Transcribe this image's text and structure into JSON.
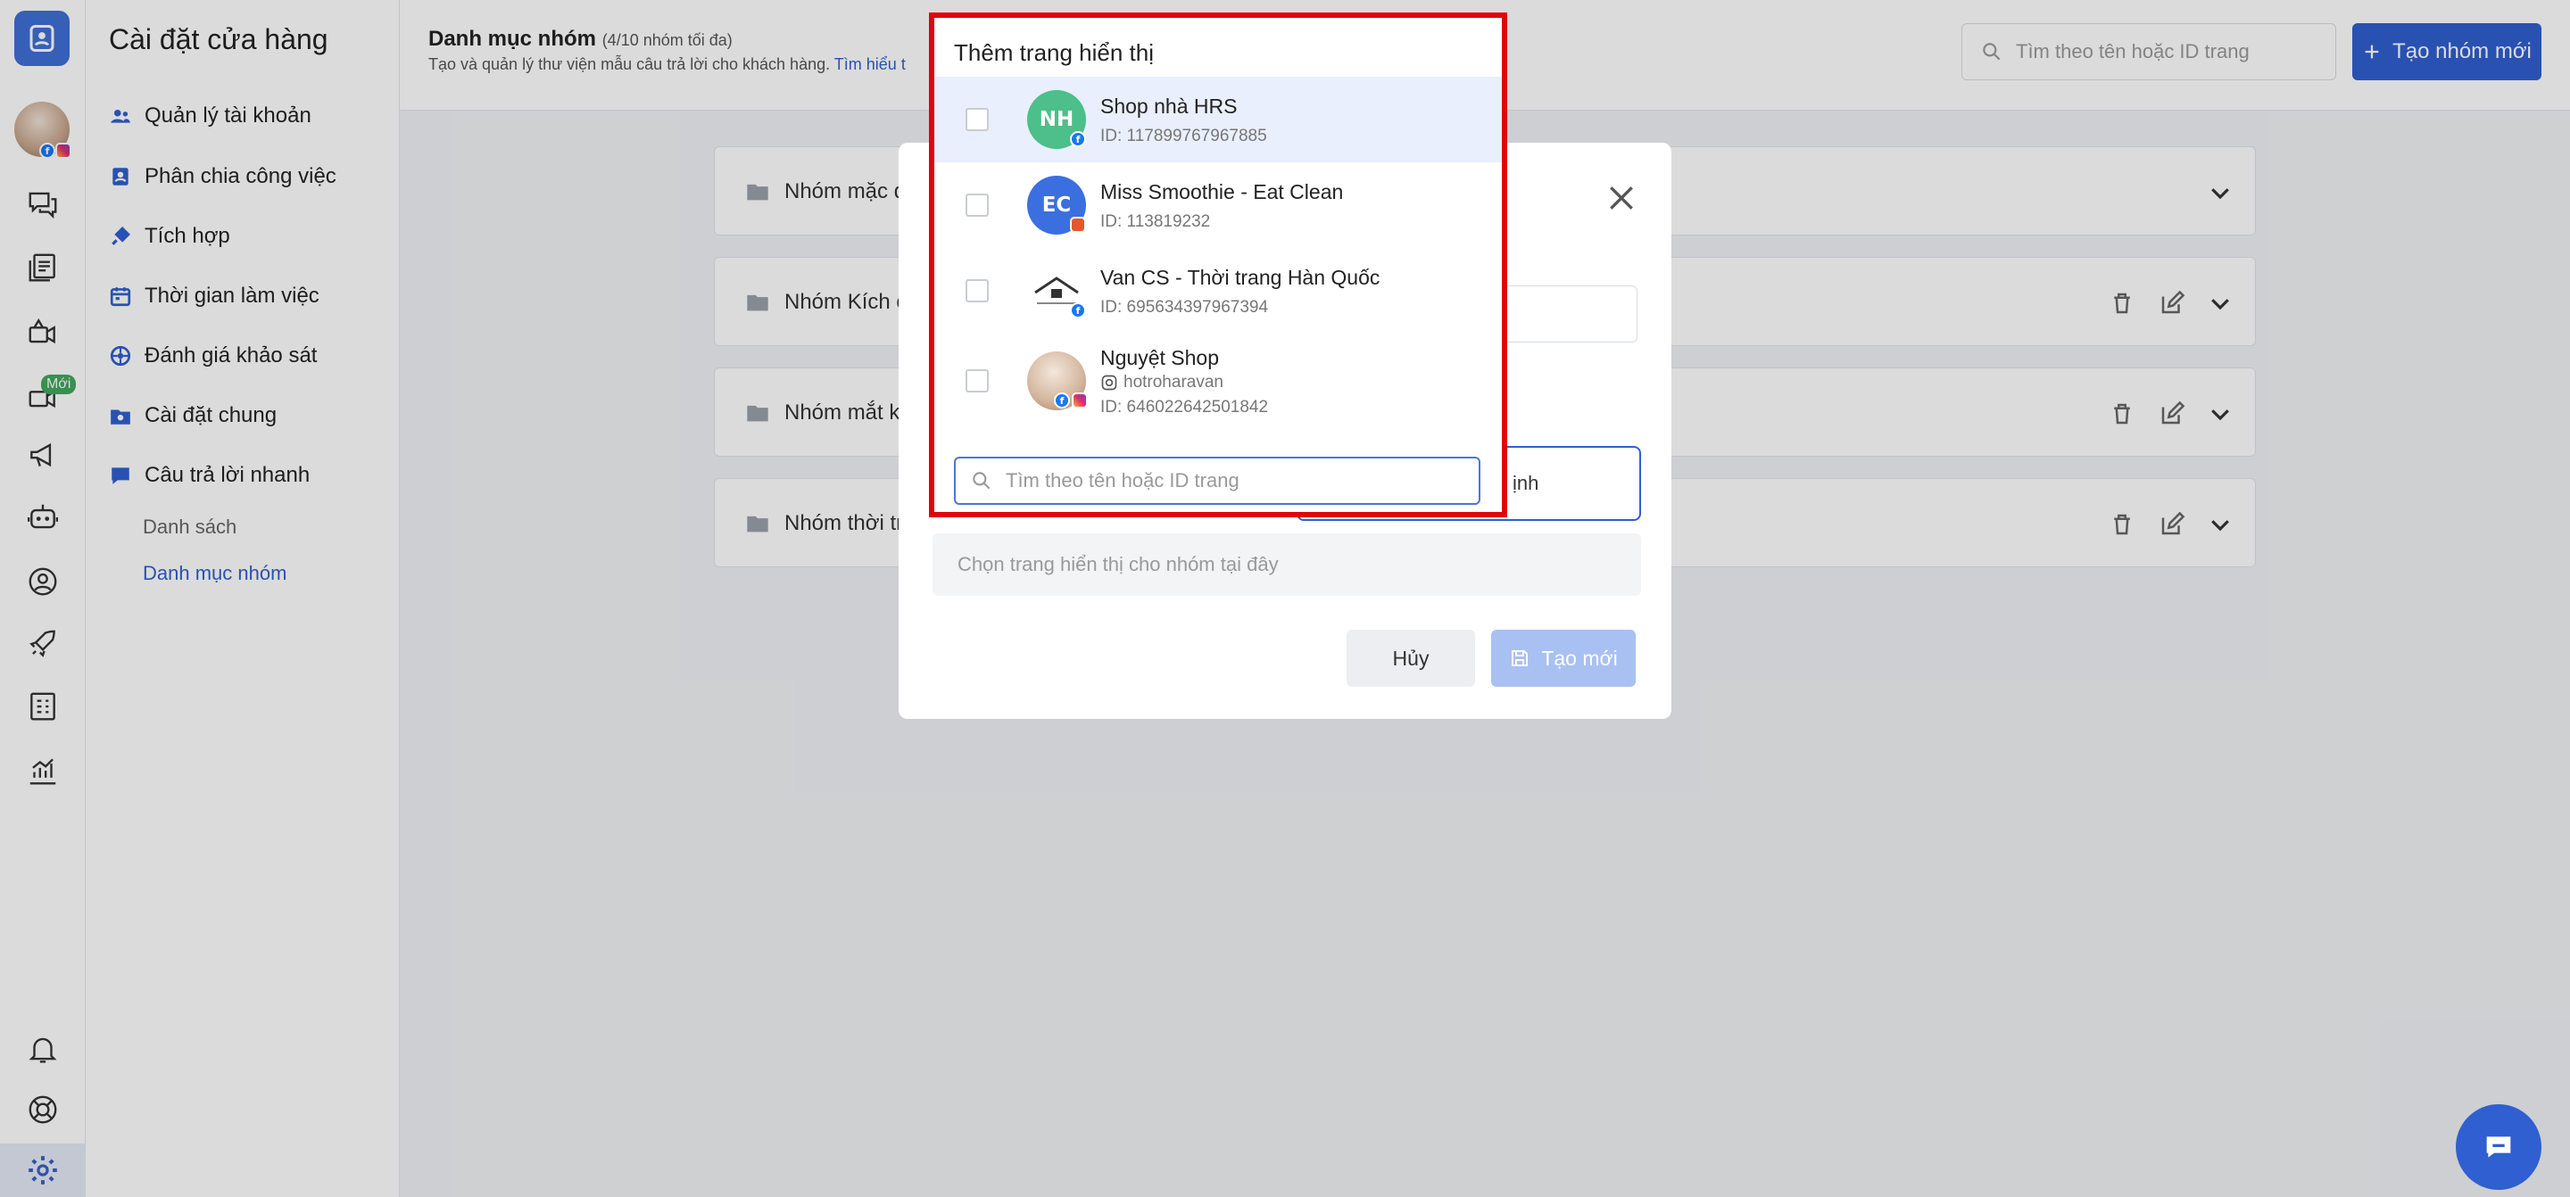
{
  "settings_nav": {
    "title": "Cài đặt cửa hàng",
    "items": [
      {
        "label": "Quản lý tài khoản",
        "icon": "users-icon"
      },
      {
        "label": "Phân chia công việc",
        "icon": "assign-icon"
      },
      {
        "label": "Tích hợp",
        "icon": "plug-icon"
      },
      {
        "label": "Thời gian làm việc",
        "icon": "calendar-icon"
      },
      {
        "label": "Đánh giá khảo sát",
        "icon": "survey-icon"
      },
      {
        "label": "Cài đặt chung",
        "icon": "folder-gear-icon"
      },
      {
        "label": "Câu trả lời nhanh",
        "icon": "chat-bubble-icon"
      }
    ],
    "sub_items": [
      {
        "label": "Danh sách"
      },
      {
        "label": "Danh mục nhóm"
      }
    ]
  },
  "rail": {
    "new_badge": "Mới"
  },
  "header": {
    "title": "Danh mục nhóm",
    "count": "(4/10 nhóm tối đa)",
    "description": "Tạo và quản lý thư viện mẫu câu trả lời cho khách hàng.",
    "learn_more": "Tìm hiểu t",
    "search_placeholder": "Tìm theo tên hoặc ID trang",
    "create_button": "Tạo nhóm mới"
  },
  "groups": [
    {
      "name": "Nhóm mặc đị"
    },
    {
      "name": "Nhóm Kích cỡ"
    },
    {
      "name": "Nhóm mắt kín"
    },
    {
      "name": "Nhóm thời tra"
    }
  ],
  "modal": {
    "select_value": "ịnh",
    "pick_placeholder": "Chọn trang hiển thị cho nhóm tại đây",
    "cancel": "Hủy",
    "create": "Tạo mới"
  },
  "dropdown": {
    "title": "Thêm trang hiển thị",
    "search_placeholder": "Tìm theo tên hoặc ID trang",
    "pages": [
      {
        "initials": "NH",
        "name": "Shop nhà HRS",
        "id": "ID: 117899767967885",
        "color": "#4cbf8a",
        "platform": "facebook"
      },
      {
        "initials": "EC",
        "name": "Miss Smoothie - Eat Clean",
        "id": "ID: 113819232",
        "color": "#3b6fe0",
        "platform": "shop"
      },
      {
        "initials": "",
        "name": "Van CS - Thời trang Hàn Quốc",
        "id": "ID: 695634397967394",
        "color": "#ffffff",
        "platform": "facebook"
      },
      {
        "initials": "",
        "name": "Nguyệt Shop",
        "handle": "hotroharavan",
        "id": "ID: 646022642501842",
        "color": "#d9c2ae",
        "platform": "facebook+instagram"
      }
    ]
  },
  "colors": {
    "accent": "#2f5fd0",
    "highlight_border": "#e0040b"
  }
}
